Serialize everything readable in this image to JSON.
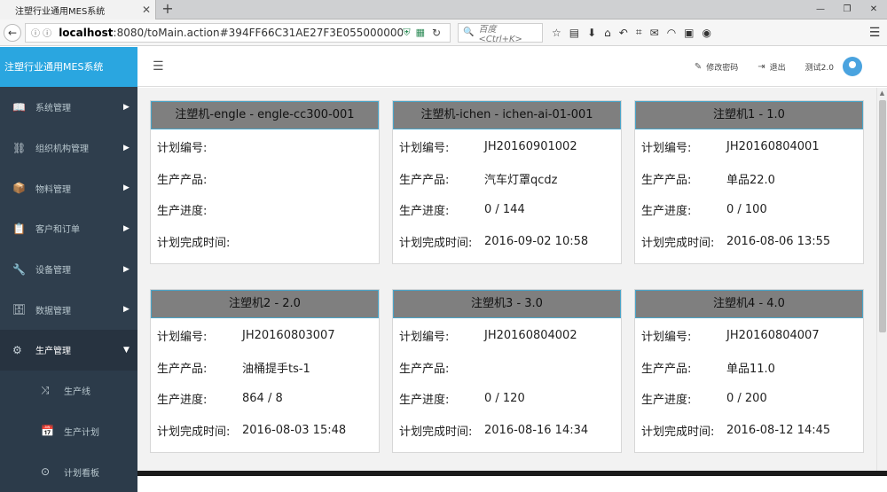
{
  "browser": {
    "tab_title": "注塑行业通用MES系统",
    "tab_close": "✕",
    "new_tab": "+",
    "url_info": "ⓘ ⓘ",
    "url_host": "localhost",
    "url_rest": ":8080/toMain.action#394FF66C31AE27F3E055000000000001",
    "search_placeholder": "百度 <Ctrl+K>"
  },
  "app": {
    "brand": "注塑行业通用MES系统",
    "topbar": {
      "change_password": "修改密码",
      "logout": "退出",
      "user": "测试2.0"
    },
    "sidebar": {
      "items": [
        {
          "label": "系统管理",
          "icon": "📖"
        },
        {
          "label": "组织机构管理",
          "icon": "⛓"
        },
        {
          "label": "物料管理",
          "icon": "📦"
        },
        {
          "label": "客户和订单",
          "icon": "📋"
        },
        {
          "label": "设备管理",
          "icon": "🔧"
        },
        {
          "label": "数据管理",
          "icon": "🗄"
        },
        {
          "label": "生产管理",
          "icon": "⚙"
        }
      ],
      "sub_items": [
        {
          "label": "生产线",
          "icon": "⤨"
        },
        {
          "label": "生产计划",
          "icon": "📅"
        },
        {
          "label": "计划看板",
          "icon": "⊙"
        }
      ]
    }
  },
  "cards": [
    {
      "title": "注塑机-engle - engle-cc300-001",
      "rows": [
        {
          "label": "计划编号:",
          "value": ""
        },
        {
          "label": "生产产品:",
          "value": ""
        },
        {
          "label": "生产进度:",
          "value": ""
        },
        {
          "label": "计划完成时间:",
          "value": ""
        }
      ]
    },
    {
      "title": "注塑机-ichen - ichen-ai-01-001",
      "rows": [
        {
          "label": "计划编号:",
          "value": "JH20160901002"
        },
        {
          "label": "生产产品:",
          "value": "汽车灯罩qcdz"
        },
        {
          "label": "生产进度:",
          "value": "0 / 144"
        },
        {
          "label": "计划完成时间:",
          "value": "2016-09-02 10:58"
        }
      ]
    },
    {
      "title": "注塑机1 - 1.0",
      "rows": [
        {
          "label": "计划编号:",
          "value": "JH20160804001"
        },
        {
          "label": "生产产品:",
          "value": "单品22.0"
        },
        {
          "label": "生产进度:",
          "value": "0 / 100"
        },
        {
          "label": "计划完成时间:",
          "value": "2016-08-06 13:55"
        }
      ]
    },
    {
      "title": "注塑机2 - 2.0",
      "rows": [
        {
          "label": "计划编号:",
          "value": "JH20160803007"
        },
        {
          "label": "生产产品:",
          "value": "油桶提手ts-1"
        },
        {
          "label": "生产进度:",
          "value": "864 / 8"
        },
        {
          "label": "计划完成时间:",
          "value": "2016-08-03 15:48"
        }
      ]
    },
    {
      "title": "注塑机3 - 3.0",
      "rows": [
        {
          "label": "计划编号:",
          "value": "JH20160804002"
        },
        {
          "label": "生产产品:",
          "value": ""
        },
        {
          "label": "生产进度:",
          "value": "0 / 120"
        },
        {
          "label": "计划完成时间:",
          "value": "2016-08-16 14:34"
        }
      ]
    },
    {
      "title": "注塑机4 - 4.0",
      "rows": [
        {
          "label": "计划编号:",
          "value": "JH20160804007"
        },
        {
          "label": "生产产品:",
          "value": "单品11.0"
        },
        {
          "label": "生产进度:",
          "value": "0 / 200"
        },
        {
          "label": "计划完成时间:",
          "value": "2016-08-12 14:45"
        }
      ]
    }
  ],
  "colors": {
    "brand_bg": "#2aa6e0",
    "sidebar_bg": "#2f3e4d",
    "card_header_bg": "#7f7f7f",
    "card_header_border": "#4aa5c9"
  }
}
